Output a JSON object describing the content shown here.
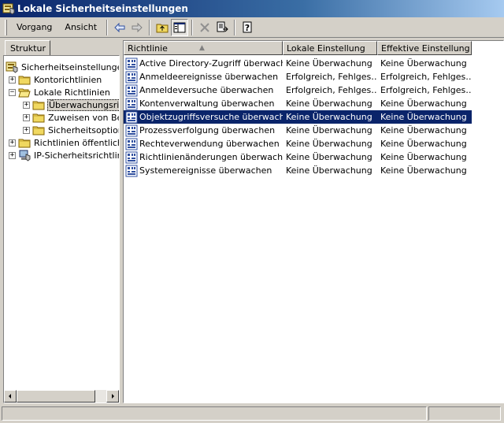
{
  "window": {
    "title": "Lokale Sicherheitseinstellungen"
  },
  "menu": {
    "items": [
      "Vorgang",
      "Ansicht"
    ]
  },
  "toolbar": {
    "buttons": [
      "back-icon",
      "forward-icon",
      "up-folder-icon",
      "show-tree-icon",
      "delete-icon",
      "export-list-icon",
      "help-icon"
    ]
  },
  "left": {
    "tab_label": "Struktur",
    "tree": [
      {
        "label": "Sicherheitseinstellungen",
        "level": 0,
        "expander": "",
        "icon": "security-settings-icon"
      },
      {
        "label": "Kontorichtlinien",
        "level": 1,
        "expander": "+",
        "icon": "folder-icon"
      },
      {
        "label": "Lokale Richtlinien",
        "level": 1,
        "expander": "−",
        "icon": "folder-open-icon"
      },
      {
        "label": "Überwachungsricht",
        "level": 2,
        "expander": "+",
        "icon": "folder-icon",
        "selected": true
      },
      {
        "label": "Zuweisen von Ber",
        "level": 2,
        "expander": "+",
        "icon": "folder-icon"
      },
      {
        "label": "Sicherheitsoptione",
        "level": 2,
        "expander": "+",
        "icon": "folder-icon"
      },
      {
        "label": "Richtlinien öffentlicher",
        "level": 1,
        "expander": "+",
        "icon": "folder-icon"
      },
      {
        "label": "IP-Sicherheitsrichtlinie",
        "level": 1,
        "expander": "+",
        "icon": "ip-security-icon"
      }
    ]
  },
  "right": {
    "columns": [
      "Richtlinie",
      "Lokale Einstellung",
      "Effektive Einstellung"
    ],
    "rows": [
      {
        "policy": "Active Directory-Zugriff überwachen",
        "local": "Keine Überwachung",
        "effective": "Keine Überwachung"
      },
      {
        "policy": "Anmeldeereignisse überwachen",
        "local": "Erfolgreich, Fehlges…",
        "effective": "Erfolgreich, Fehlges…"
      },
      {
        "policy": "Anmeldeversuche überwachen",
        "local": "Erfolgreich, Fehlges…",
        "effective": "Erfolgreich, Fehlges…"
      },
      {
        "policy": "Kontenverwaltung überwachen",
        "local": "Keine Überwachung",
        "effective": "Keine Überwachung"
      },
      {
        "policy": "Objektzugriffsversuche überwachen",
        "local": "Keine Überwachung",
        "effective": "Keine Überwachung",
        "selected": true
      },
      {
        "policy": "Prozessverfolgung überwachen",
        "local": "Keine Überwachung",
        "effective": "Keine Überwachung"
      },
      {
        "policy": "Rechteverwendung überwachen",
        "local": "Keine Überwachung",
        "effective": "Keine Überwachung"
      },
      {
        "policy": "Richtlinienänderungen überwachen",
        "local": "Keine Überwachung",
        "effective": "Keine Überwachung"
      },
      {
        "policy": "Systemereignisse überwachen",
        "local": "Keine Überwachung",
        "effective": "Keine Überwachung"
      }
    ]
  },
  "colors": {
    "title_start": "#0a246a",
    "title_end": "#a6caf0",
    "selection": "#0a246a",
    "face": "#d4d0c8"
  }
}
